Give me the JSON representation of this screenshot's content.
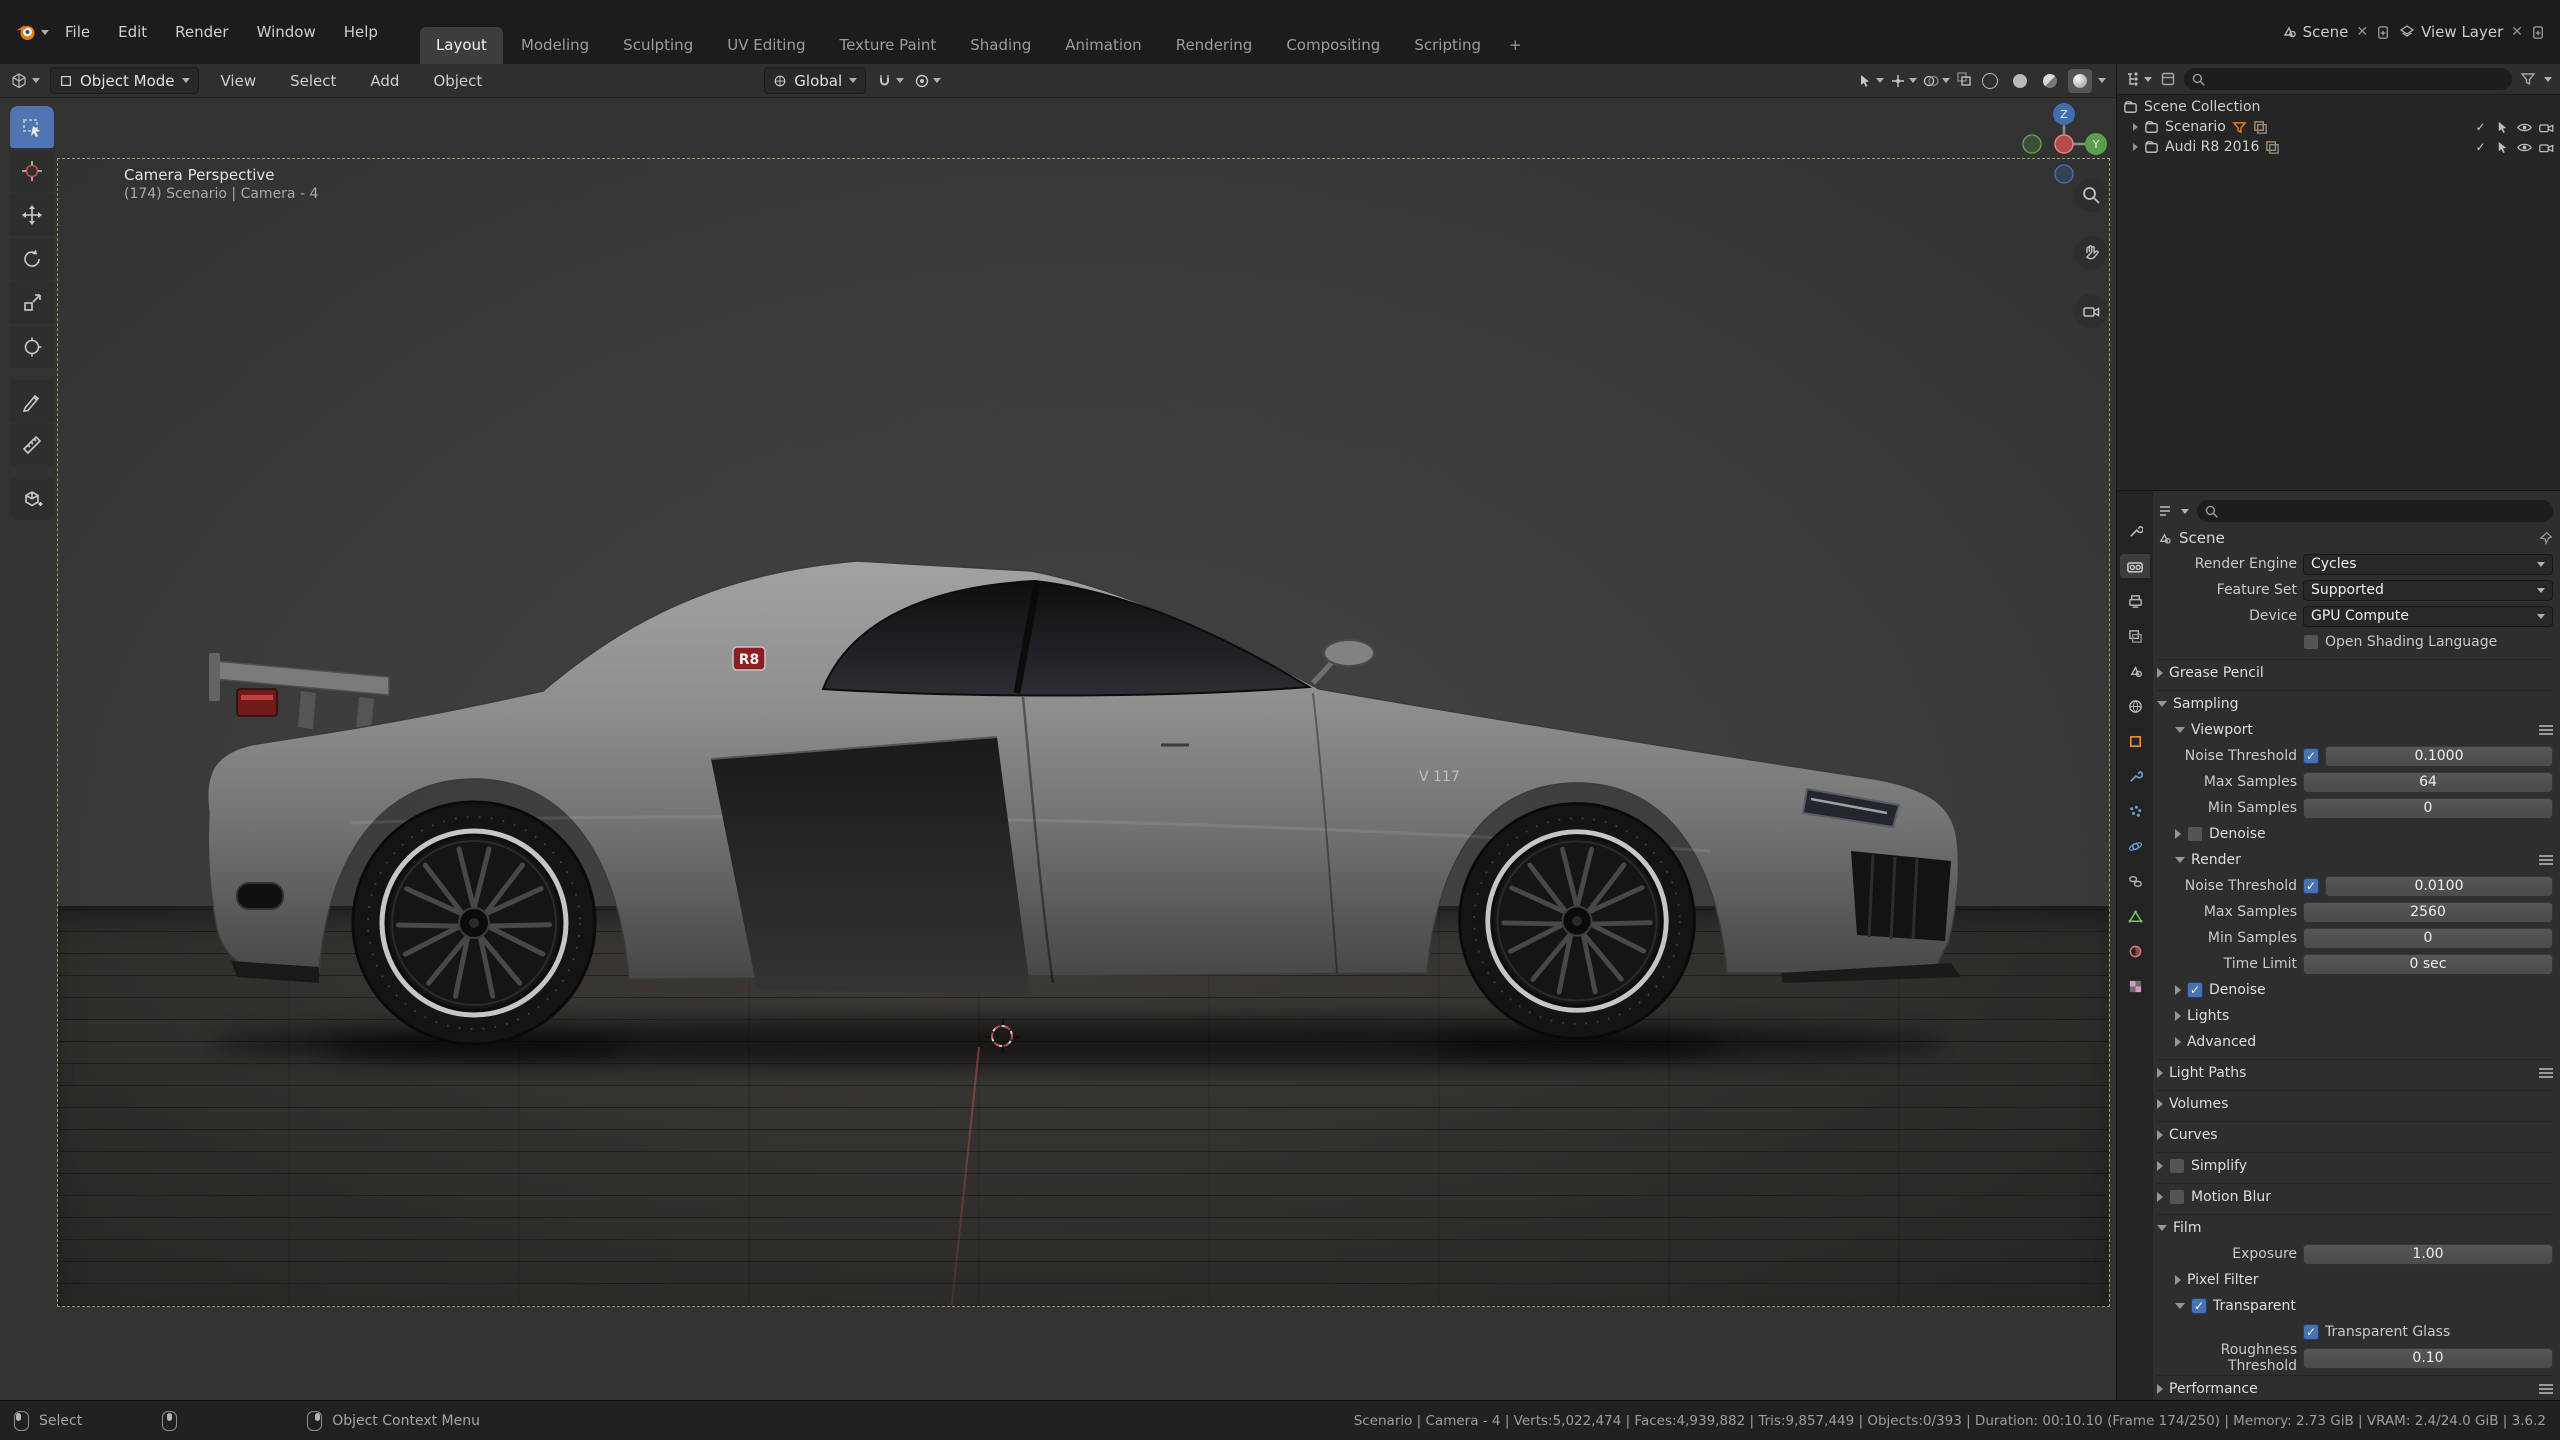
{
  "topbar": {
    "menus": [
      "File",
      "Edit",
      "Render",
      "Window",
      "Help"
    ],
    "workspaces": [
      "Layout",
      "Modeling",
      "Sculpting",
      "UV Editing",
      "Texture Paint",
      "Shading",
      "Animation",
      "Rendering",
      "Compositing",
      "Scripting"
    ],
    "active_workspace": "Layout",
    "add_workspace": "+",
    "scene_label": "Scene",
    "view_layer_label": "View Layer"
  },
  "viewport_header": {
    "mode": "Object Mode",
    "menus": [
      "View",
      "Select",
      "Add",
      "Object"
    ],
    "orientation": "Global"
  },
  "viewport": {
    "view_name": "Camera Perspective",
    "view_context": "(174) Scenario | Camera - 4",
    "gizmo_axes": {
      "z": "Z",
      "y": "Y"
    },
    "car_badge": "R8",
    "car_decal": "V 117"
  },
  "tools": [
    "select-box",
    "cursor",
    "move",
    "rotate",
    "scale",
    "transform",
    "annotate",
    "measure",
    "add-cube"
  ],
  "outliner": {
    "rows": [
      {
        "label": "Scene Collection"
      },
      {
        "label": "Scenario"
      },
      {
        "label": "Audi R8 2016"
      }
    ]
  },
  "properties": {
    "breadcrumb": "Scene",
    "render_engine": {
      "label": "Render Engine",
      "value": "Cycles"
    },
    "feature_set": {
      "label": "Feature Set",
      "value": "Supported"
    },
    "device": {
      "label": "Device",
      "value": "GPU Compute"
    },
    "osl": {
      "label": "Open Shading Language",
      "checked": false
    },
    "grease_pencil": {
      "label": "Grease Pencil"
    },
    "sampling": {
      "label": "Sampling"
    },
    "viewport_panel": {
      "label": "Viewport"
    },
    "viewport_noise_threshold": {
      "label": "Noise Threshold",
      "value": "0.1000",
      "checked": true
    },
    "viewport_max_samples": {
      "label": "Max Samples",
      "value": "64"
    },
    "viewport_min_samples": {
      "label": "Min Samples",
      "value": "0"
    },
    "viewport_denoise": {
      "label": "Denoise",
      "checked": false
    },
    "render_panel": {
      "label": "Render"
    },
    "render_noise_threshold": {
      "label": "Noise Threshold",
      "value": "0.0100",
      "checked": true
    },
    "render_max_samples": {
      "label": "Max Samples",
      "value": "2560"
    },
    "render_min_samples": {
      "label": "Min Samples",
      "value": "0"
    },
    "time_limit": {
      "label": "Time Limit",
      "value": "0 sec"
    },
    "render_denoise": {
      "label": "Denoise",
      "checked": true
    },
    "lights": {
      "label": "Lights"
    },
    "advanced": {
      "label": "Advanced"
    },
    "light_paths": {
      "label": "Light Paths"
    },
    "volumes": {
      "label": "Volumes"
    },
    "curves": {
      "label": "Curves"
    },
    "simplify": {
      "label": "Simplify",
      "checked": false
    },
    "motion_blur": {
      "label": "Motion Blur",
      "checked": false
    },
    "film": {
      "label": "Film"
    },
    "exposure": {
      "label": "Exposure",
      "value": "1.00"
    },
    "pixel_filter": {
      "label": "Pixel Filter"
    },
    "transparent": {
      "label": "Transparent",
      "checked": true
    },
    "transparent_glass": {
      "label": "Transparent Glass",
      "checked": true
    },
    "roughness_threshold": {
      "label": "Roughness Threshold",
      "value": "0.10"
    },
    "performance": {
      "label": "Performance"
    }
  },
  "statusbar": {
    "select_hint": "Select",
    "context_menu_hint": "Object Context Menu",
    "stats": "Scenario | Camera - 4 | Verts:5,022,474 | Faces:4,939,882 | Tris:9,857,449 | Objects:0/393 | Duration: 00:10.10 (Frame 174/250) | Memory: 2.73 GiB | VRAM: 2.4/24.0 GiB | 3.6.2"
  }
}
